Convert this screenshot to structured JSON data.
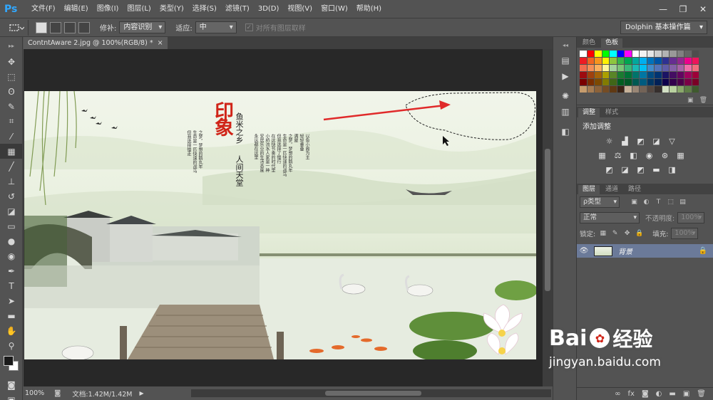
{
  "app": {
    "logo": "Ps"
  },
  "menu": [
    "文件(F)",
    "编辑(E)",
    "图像(I)",
    "图层(L)",
    "类型(Y)",
    "选择(S)",
    "滤镜(T)",
    "3D(D)",
    "视图(V)",
    "窗口(W)",
    "帮助(H)"
  ],
  "window_controls": {
    "minimize": "—",
    "restore": "❐",
    "close": "✕"
  },
  "options": {
    "patch_label": "修补:",
    "patch_value": "内容识别",
    "adapt_label": "适应:",
    "adapt_value": "中",
    "sample_all_label": "对所有图层取样",
    "workspace": "Dolphin 基本操作篇"
  },
  "document": {
    "tab_title": "ContntAware 2.jpg @ 100%(RGB/8) *",
    "close": "×",
    "zoom": "100%",
    "doc_info": "文档:1.42M/1.42M"
  },
  "image_text": {
    "title": "印象",
    "subtitle_a": "鱼米之乡",
    "subtitle_b": "人间天堂",
    "poem_right": [
      "以鱼小阁为主",
      "轻轻重叠",
      "满屋",
      "之梦，梦想的鹅丸年",
      "生命是一匹快速的战马",
      "但我选择了慢行",
      "在这快节奏的时代里",
      "小桥流水人家是一种",
      "安居乐业的生活态度",
      "永远都在这里"
    ],
    "poem_left": [
      "之梦，梦想的鹅丸年",
      "生命是一匹快速的战马",
      "但我选择慢走"
    ]
  },
  "panels": {
    "color_tab": "颜色",
    "swatches_tab": "色板",
    "adjust_tab": "调整",
    "styles_tab": "样式",
    "add_adjust": "添加调整",
    "layers_tab": "图层",
    "channels_tab": "通道",
    "paths_tab": "路径",
    "kind_filter": "ρ类型",
    "blend_mode": "正常",
    "opacity_label": "不透明度:",
    "opacity_value": "100%",
    "lock_label": "锁定:",
    "fill_label": "填充:",
    "fill_value": "100%",
    "layer_name": "背景"
  },
  "watermark": {
    "brand_a": "Bai",
    "brand_b": "经验",
    "url": "jingyan.baidu.com"
  },
  "swatch_colors": [
    "#ffffff",
    "#ff0000",
    "#ffff00",
    "#00ff00",
    "#00ffff",
    "#0000ff",
    "#ff00ff",
    "#ffffff",
    "#f2f2f2",
    "#e6e6e6",
    "#cccccc",
    "#b3b3b3",
    "#999999",
    "#808080",
    "#666666",
    "#4d4d4d",
    "#ed1c24",
    "#f26522",
    "#f7941d",
    "#fff200",
    "#8dc63f",
    "#39b54a",
    "#00a651",
    "#00a99d",
    "#00aeef",
    "#0072bc",
    "#0054a6",
    "#2e3192",
    "#662d91",
    "#92278f",
    "#ec008c",
    "#ed145b",
    "#f26c4f",
    "#f68e56",
    "#fbaf5d",
    "#fff799",
    "#a3d39c",
    "#7cc576",
    "#3bb878",
    "#1abbb4",
    "#00bff3",
    "#438ccb",
    "#5574b9",
    "#605ca8",
    "#855fa8",
    "#a763a8",
    "#f06eaa",
    "#f26d7d",
    "#9e0b0f",
    "#a0410d",
    "#a36209",
    "#aba000",
    "#598527",
    "#1a7b30",
    "#007236",
    "#00746b",
    "#0076a3",
    "#004b80",
    "#003471",
    "#1b1464",
    "#440e62",
    "#630460",
    "#9e005d",
    "#9e0039",
    "#790000",
    "#7b2e00",
    "#7d4900",
    "#827b00",
    "#406618",
    "#005e20",
    "#005826",
    "#005952",
    "#005b7f",
    "#003663",
    "#002157",
    "#0d004c",
    "#32004b",
    "#4b0049",
    "#7b0046",
    "#7a0026",
    "#c69c6d",
    "#a67c52",
    "#8c6239",
    "#754c24",
    "#603913",
    "#3c2415",
    "#c7b299",
    "#998675",
    "#736357",
    "#534741",
    "#362f2d",
    "#d2e0c4",
    "#b9d19f",
    "#8aa86b",
    "#5f7e47",
    "#3f5a2e"
  ]
}
